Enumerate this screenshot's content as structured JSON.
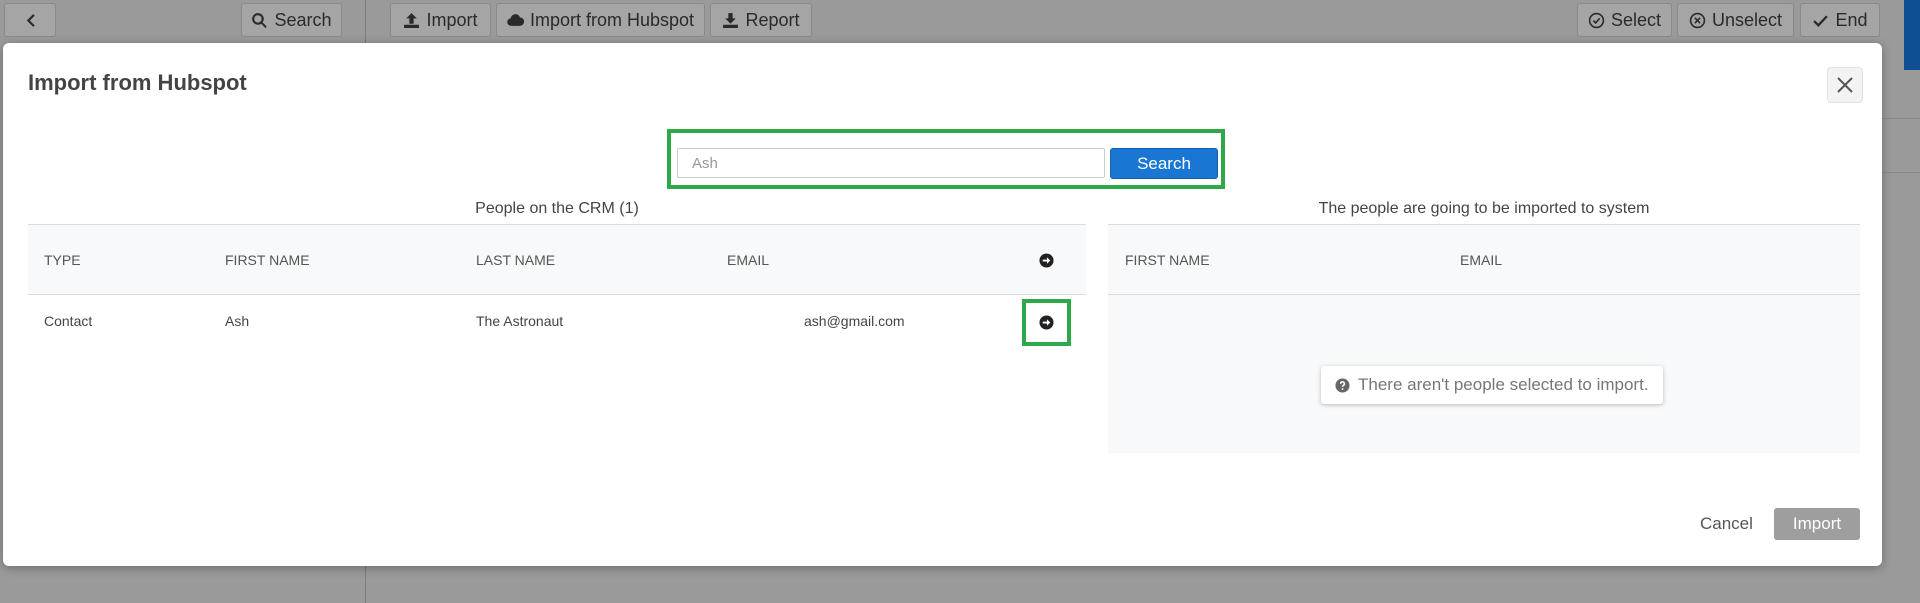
{
  "background": {
    "search_label": "Search",
    "import_label": "Import",
    "import_hubspot_label": "Import from Hubspot",
    "report_label": "Report",
    "select_label": "Select",
    "unselect_label": "Unselect",
    "end_label": "End"
  },
  "modal": {
    "title": "Import from Hubspot",
    "search": {
      "value": "Ash",
      "button_label": "Search"
    },
    "crm_panel": {
      "title": "People on the CRM (1)",
      "columns": [
        "TYPE",
        "FIRST NAME",
        "LAST NAME",
        "EMAIL"
      ],
      "rows": [
        {
          "type": "Contact",
          "first_name": "Ash",
          "last_name": "The Astronaut",
          "email": "ash@gmail.com"
        }
      ]
    },
    "import_panel": {
      "title": "The people are going to be imported to system",
      "columns": [
        "FIRST NAME",
        "EMAIL"
      ],
      "empty_message": "There aren't people selected to import."
    },
    "cancel_label": "Cancel",
    "import_label": "Import"
  },
  "colors": {
    "primary": "#1976d2",
    "highlight": "#2ea84a",
    "disabled": "#9e9e9e"
  }
}
